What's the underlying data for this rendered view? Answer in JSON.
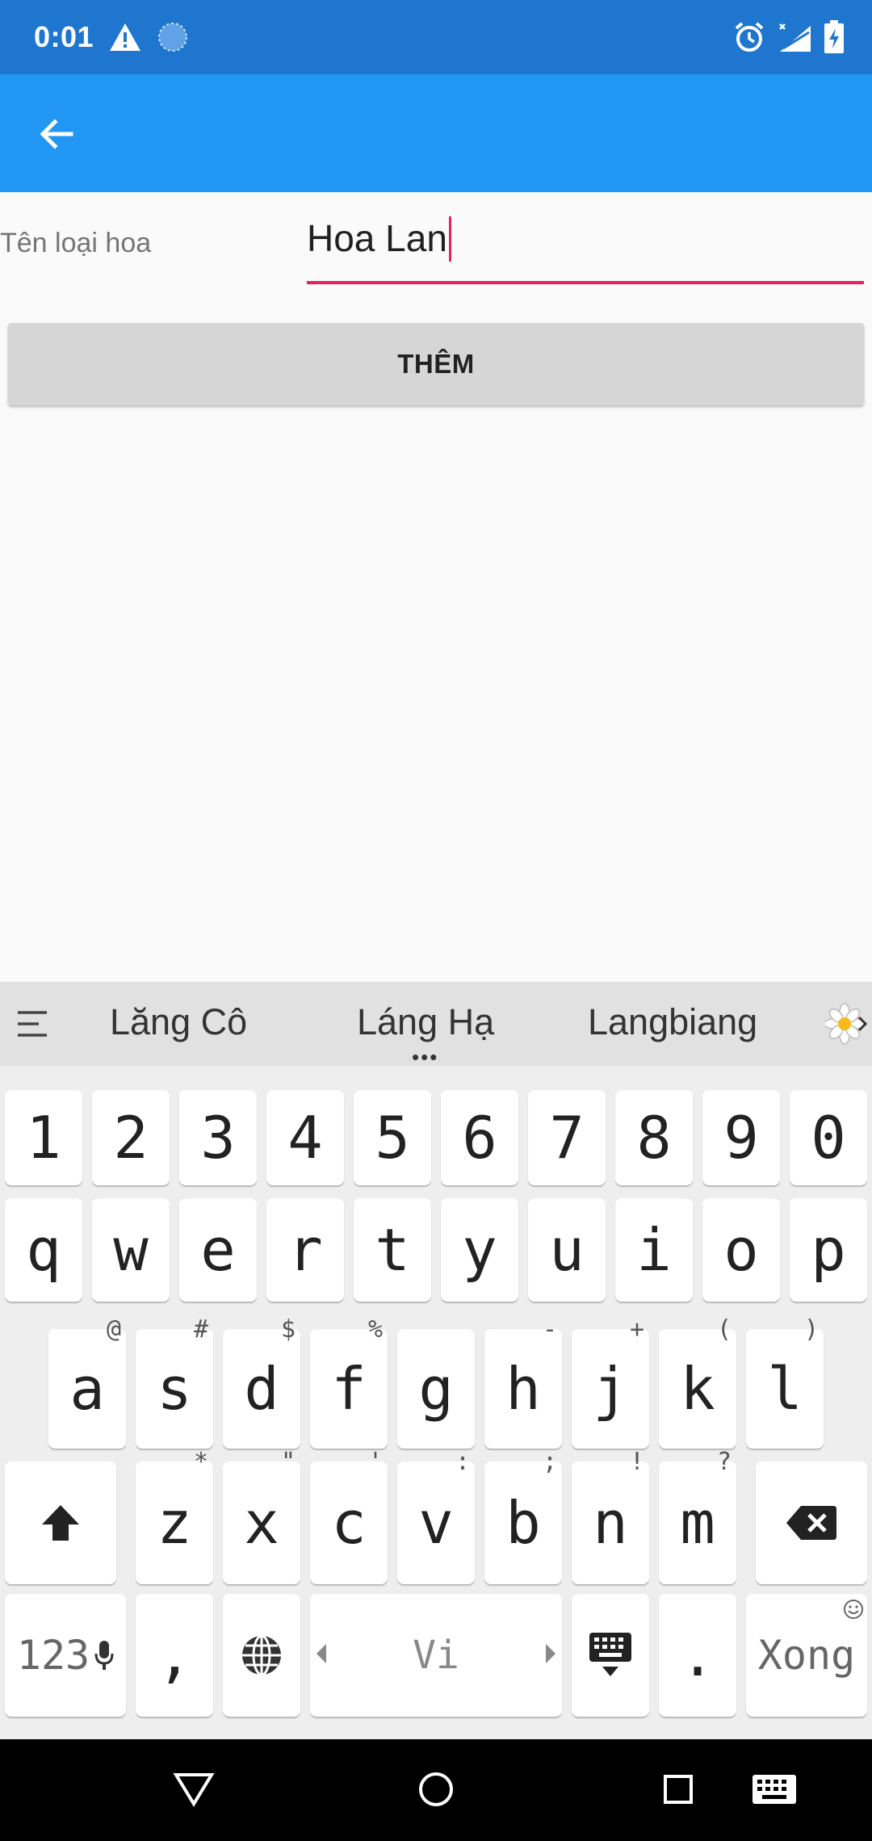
{
  "status_bar": {
    "time": "0:01",
    "icons": [
      "warning-icon",
      "sync-icon",
      "alarm-icon",
      "signal-off-icon",
      "battery-charging-icon"
    ]
  },
  "app_bar": {
    "back_icon": "arrow-back-icon"
  },
  "form": {
    "label": "Tên loại hoa",
    "input_value": "Hoa Lan",
    "add_button_label": "THÊM"
  },
  "colors": {
    "status_bar": "#1E76CF",
    "app_bar": "#2196F3",
    "accent": "#E91E63",
    "button": "#D6D6D6"
  },
  "keyboard": {
    "suggestions": [
      "Lăng Cô",
      "Láng Hạ",
      "Langbiang"
    ],
    "row_numbers": [
      "1",
      "2",
      "3",
      "4",
      "5",
      "6",
      "7",
      "8",
      "9",
      "0"
    ],
    "row_q": [
      "q",
      "w",
      "e",
      "r",
      "t",
      "y",
      "u",
      "i",
      "o",
      "p"
    ],
    "row_a": [
      {
        "key": "a",
        "hint": "@"
      },
      {
        "key": "s",
        "hint": "#"
      },
      {
        "key": "d",
        "hint": "$"
      },
      {
        "key": "f",
        "hint": "%"
      },
      {
        "key": "g",
        "hint": ""
      },
      {
        "key": "h",
        "hint": "-"
      },
      {
        "key": "j",
        "hint": "+"
      },
      {
        "key": "k",
        "hint": "("
      },
      {
        "key": "l",
        "hint": ")"
      }
    ],
    "row_z": [
      {
        "key": "z",
        "hint": "*"
      },
      {
        "key": "x",
        "hint": "\""
      },
      {
        "key": "c",
        "hint": "'"
      },
      {
        "key": "v",
        "hint": ":"
      },
      {
        "key": "b",
        "hint": ";"
      },
      {
        "key": "n",
        "hint": "!"
      },
      {
        "key": "m",
        "hint": "?"
      }
    ],
    "symbols_label": "123",
    "comma": ",",
    "space_label": "Vi",
    "period": ".",
    "done_label": "Xong"
  },
  "nav_bar": {
    "icons": [
      "back-triangle-icon",
      "home-circle-icon",
      "recents-square-icon",
      "keyboard-switch-icon"
    ]
  }
}
